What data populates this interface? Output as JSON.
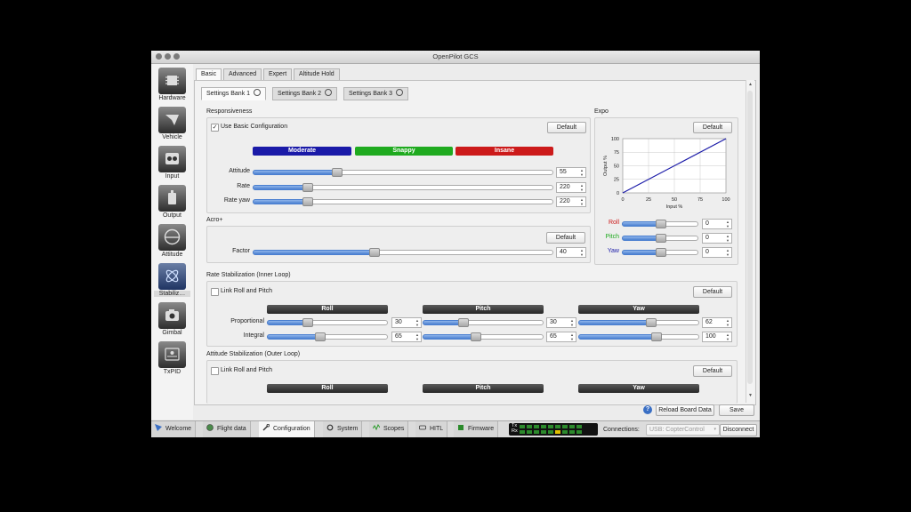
{
  "window": {
    "title": "OpenPilot GCS"
  },
  "sidebar": {
    "items": [
      {
        "label": "Hardware",
        "icon": "chip-icon"
      },
      {
        "label": "Vehicle",
        "icon": "vehicle-icon"
      },
      {
        "label": "Input",
        "icon": "gamepad-icon"
      },
      {
        "label": "Output",
        "icon": "motor-icon"
      },
      {
        "label": "Attitude",
        "icon": "attitude-icon"
      },
      {
        "label": "Stabiliz…",
        "icon": "stabilization-icon"
      },
      {
        "label": "Gimbal",
        "icon": "camera-icon"
      },
      {
        "label": "TxPID",
        "icon": "txpid-icon"
      }
    ]
  },
  "tabs": [
    "Basic",
    "Advanced",
    "Expert",
    "Altitude Hold"
  ],
  "banks": [
    "Settings Bank 1",
    "Settings Bank 2",
    "Settings Bank 3"
  ],
  "responsiveness": {
    "title": "Responsiveness",
    "use_basic_label": "Use Basic Configuration",
    "use_basic_checked": "✓",
    "default_label": "Default",
    "presets": [
      {
        "label": "Moderate",
        "color": "#1a1aa8"
      },
      {
        "label": "Snappy",
        "color": "#1faa1f"
      },
      {
        "label": "Insane",
        "color": "#cc1a1a"
      }
    ],
    "rows": [
      {
        "label": "Attitude",
        "value": "55",
        "level": 0.27
      },
      {
        "label": "Rate",
        "value": "220",
        "level": 0.17
      },
      {
        "label": "Rate yaw",
        "value": "220",
        "level": 0.17
      }
    ]
  },
  "acro": {
    "title": "Acro+",
    "default_label": "Default",
    "factor_label": "Factor",
    "factor_value": "40",
    "factor_level": 0.4
  },
  "expo": {
    "title": "Expo",
    "default_label": "Default",
    "ylabel": "Output %",
    "xlabel": "Input %",
    "xticks": [
      "0",
      "25",
      "50",
      "75",
      "100"
    ],
    "yticks": [
      "0",
      "25",
      "50",
      "75",
      "100"
    ],
    "line_color": "#1a1aa8",
    "axes": [
      {
        "label": "Roll",
        "color": "#cc1a1a",
        "value": "0",
        "level": 0.5
      },
      {
        "label": "Pitch",
        "color": "#1faa1f",
        "value": "0",
        "level": 0.5
      },
      {
        "label": "Yaw",
        "color": "#1a1aa8",
        "value": "0",
        "level": 0.5
      }
    ]
  },
  "rate_stab": {
    "title": "Rate Stabilization (Inner Loop)",
    "link_label": "Link Roll and Pitch",
    "default_label": "Default",
    "columns": [
      "Roll",
      "Pitch",
      "Yaw"
    ],
    "rows": [
      {
        "label": "Proportional",
        "values": [
          "30",
          "30",
          "62"
        ],
        "levels": [
          0.32,
          0.32,
          0.6
        ]
      },
      {
        "label": "Integral",
        "values": [
          "65",
          "65",
          "100"
        ],
        "levels": [
          0.43,
          0.43,
          0.65
        ]
      }
    ]
  },
  "att_stab": {
    "title": "Attitude Stabilization (Outer Loop)",
    "link_label": "Link Roll and Pitch",
    "default_label": "Default",
    "columns": [
      "Roll",
      "Pitch",
      "Yaw"
    ]
  },
  "actions": {
    "help": "?",
    "reload_label": "Reload Board Data",
    "save_label": "Save"
  },
  "bottom_tabs": [
    "Welcome",
    "Flight data",
    "Configuration",
    "System",
    "Scopes",
    "HITL",
    "Firmware"
  ],
  "telemetry": {
    "tx": "Tx",
    "rx": "Rx"
  },
  "connection": {
    "label": "Connections:",
    "value": "USB: CopterControl",
    "disconnect_label": "Disconnect"
  }
}
